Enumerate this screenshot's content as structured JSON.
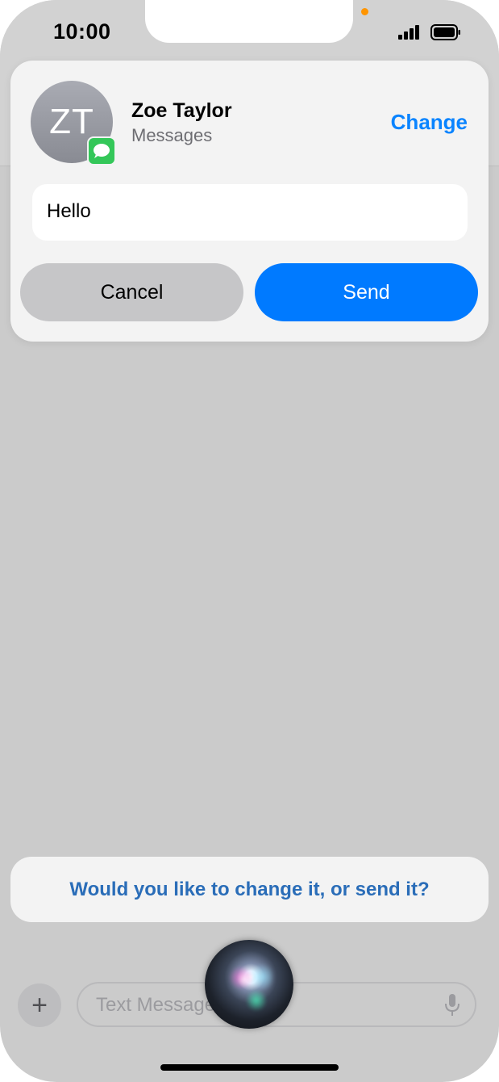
{
  "status_bar": {
    "time": "10:00"
  },
  "card": {
    "avatar_initials": "ZT",
    "contact_name": "Zoe Taylor",
    "contact_app": "Messages",
    "change_label": "Change",
    "message_text": "Hello",
    "cancel_label": "Cancel",
    "send_label": "Send"
  },
  "siri": {
    "prompt": "Would you like to change it, or send it?"
  },
  "composer": {
    "plus_label": "+",
    "placeholder": "Text Message • SMS"
  },
  "colors": {
    "accent": "#007AFF",
    "messages_green": "#34C759",
    "notch_indicator": "#FF9500"
  },
  "icons": {
    "signal": "cellular-signal-icon",
    "battery": "battery-icon",
    "app_badge": "messages-app-icon",
    "mic": "microphone-icon",
    "siri": "siri-orb-icon"
  }
}
